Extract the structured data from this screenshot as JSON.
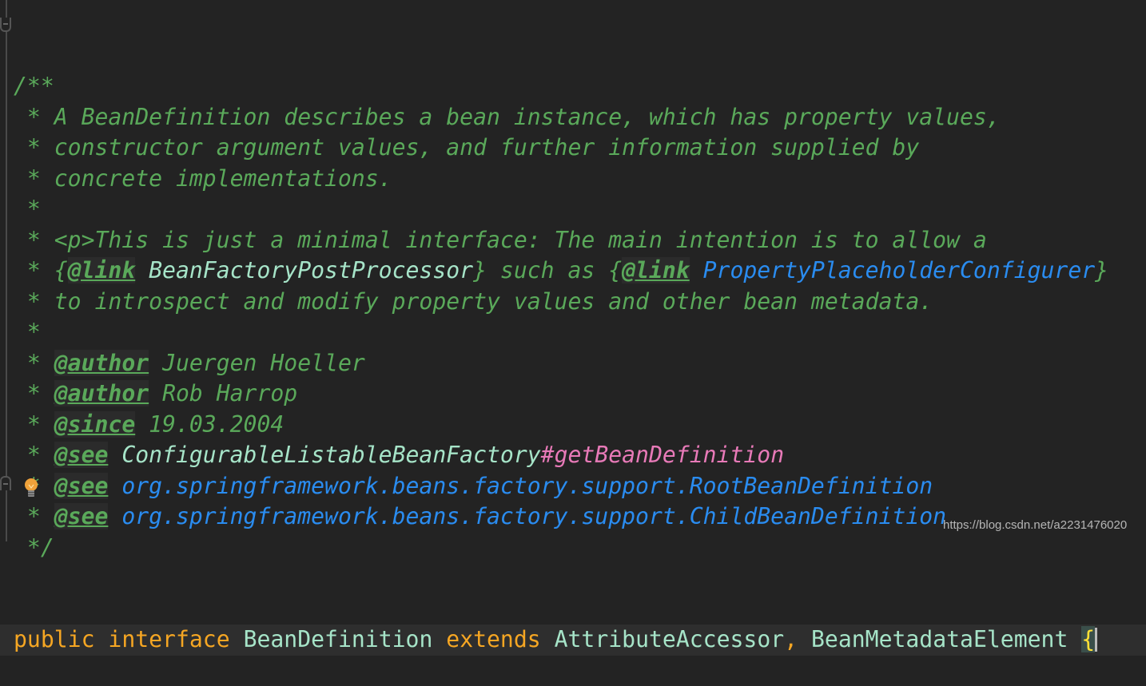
{
  "lines": [
    [
      {
        "t": "/**",
        "s": "c"
      }
    ],
    [
      {
        "t": " * A BeanDefinition describes a bean instance, which has property values,",
        "s": "c"
      }
    ],
    [
      {
        "t": " * constructor argument values, and further information supplied by",
        "s": "c"
      }
    ],
    [
      {
        "t": " * concrete implementations.",
        "s": "c"
      }
    ],
    [
      {
        "t": " *",
        "s": "c"
      }
    ],
    [
      {
        "t": " * <p>This is just a minimal interface: The main intention is to allow a",
        "s": "c"
      }
    ],
    [
      {
        "t": " * {",
        "s": "c"
      },
      {
        "t": "@link",
        "s": "tag"
      },
      {
        "t": " BeanFactoryPostProcessor",
        "s": "ref"
      },
      {
        "t": "} such as {",
        "s": "c"
      },
      {
        "t": "@link",
        "s": "tag"
      },
      {
        "t": " PropertyPlaceholderConfigurer",
        "s": "lnk"
      },
      {
        "t": "}",
        "s": "c"
      }
    ],
    [
      {
        "t": " * to introspect and modify property values and other bean metadata.",
        "s": "c"
      }
    ],
    [
      {
        "t": " *",
        "s": "c"
      }
    ],
    [
      {
        "t": " * ",
        "s": "c"
      },
      {
        "t": "@author",
        "s": "tag"
      },
      {
        "t": " Juergen Hoeller",
        "s": "c"
      }
    ],
    [
      {
        "t": " * ",
        "s": "c"
      },
      {
        "t": "@author",
        "s": "tag"
      },
      {
        "t": " Rob Harrop",
        "s": "c"
      }
    ],
    [
      {
        "t": " * ",
        "s": "c"
      },
      {
        "t": "@since",
        "s": "tag"
      },
      {
        "t": " 19.03.2004",
        "s": "c"
      }
    ],
    [
      {
        "t": " * ",
        "s": "c"
      },
      {
        "t": "@see",
        "s": "tag"
      },
      {
        "t": " ConfigurableListableBeanFactory",
        "s": "ref"
      },
      {
        "t": "#getBeanDefinition",
        "s": "meth"
      }
    ],
    [
      {
        "t": " * ",
        "s": "c"
      },
      {
        "t": "@see",
        "s": "tag"
      },
      {
        "t": " org.springframework.beans.factory.support.RootBeanDefinition",
        "s": "lnk"
      }
    ],
    [
      {
        "t": " * ",
        "s": "c"
      },
      {
        "t": "@see",
        "s": "tag"
      },
      {
        "t": " org.springframework.beans.factory.support.ChildBeanDefinition",
        "s": "lnk"
      }
    ],
    [
      {
        "t": " */",
        "s": "c"
      }
    ]
  ],
  "declaration": {
    "public": "public",
    "interface": "interface",
    "name": "BeanDefinition",
    "extends": "extends",
    "parent1": "AttributeAccessor",
    "comma": ",",
    "parent2": "BeanMetadataElement",
    "brace": "{"
  },
  "icons": {
    "intention": "lightbulb-icon",
    "fold": "fold-icon"
  },
  "watermark": "https://blog.csdn.net/a2231476020",
  "colors": {
    "background": "#232323",
    "comment": "#5aa95a",
    "keyword": "#f5a623",
    "class": "#a6e4c8",
    "link": "#2a8cf0",
    "method": "#e87ab8"
  }
}
